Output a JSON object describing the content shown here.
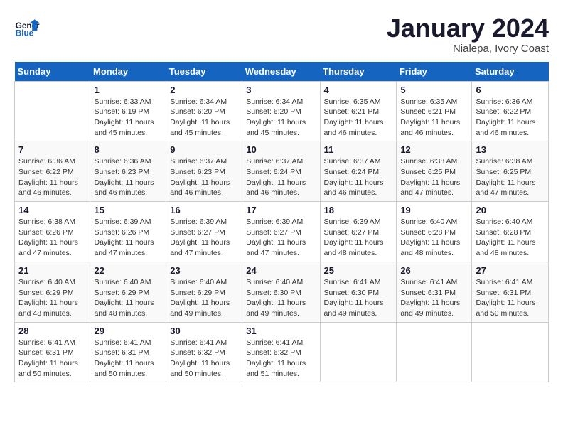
{
  "header": {
    "logo_line1": "General",
    "logo_line2": "Blue",
    "month_title": "January 2024",
    "location": "Nialepa, Ivory Coast"
  },
  "weekdays": [
    "Sunday",
    "Monday",
    "Tuesday",
    "Wednesday",
    "Thursday",
    "Friday",
    "Saturday"
  ],
  "weeks": [
    [
      {
        "day": "",
        "info": ""
      },
      {
        "day": "1",
        "info": "Sunrise: 6:33 AM\nSunset: 6:19 PM\nDaylight: 11 hours and 45 minutes."
      },
      {
        "day": "2",
        "info": "Sunrise: 6:34 AM\nSunset: 6:20 PM\nDaylight: 11 hours and 45 minutes."
      },
      {
        "day": "3",
        "info": "Sunrise: 6:34 AM\nSunset: 6:20 PM\nDaylight: 11 hours and 45 minutes."
      },
      {
        "day": "4",
        "info": "Sunrise: 6:35 AM\nSunset: 6:21 PM\nDaylight: 11 hours and 46 minutes."
      },
      {
        "day": "5",
        "info": "Sunrise: 6:35 AM\nSunset: 6:21 PM\nDaylight: 11 hours and 46 minutes."
      },
      {
        "day": "6",
        "info": "Sunrise: 6:36 AM\nSunset: 6:22 PM\nDaylight: 11 hours and 46 minutes."
      }
    ],
    [
      {
        "day": "7",
        "info": "Sunrise: 6:36 AM\nSunset: 6:22 PM\nDaylight: 11 hours and 46 minutes."
      },
      {
        "day": "8",
        "info": "Sunrise: 6:36 AM\nSunset: 6:23 PM\nDaylight: 11 hours and 46 minutes."
      },
      {
        "day": "9",
        "info": "Sunrise: 6:37 AM\nSunset: 6:23 PM\nDaylight: 11 hours and 46 minutes."
      },
      {
        "day": "10",
        "info": "Sunrise: 6:37 AM\nSunset: 6:24 PM\nDaylight: 11 hours and 46 minutes."
      },
      {
        "day": "11",
        "info": "Sunrise: 6:37 AM\nSunset: 6:24 PM\nDaylight: 11 hours and 46 minutes."
      },
      {
        "day": "12",
        "info": "Sunrise: 6:38 AM\nSunset: 6:25 PM\nDaylight: 11 hours and 47 minutes."
      },
      {
        "day": "13",
        "info": "Sunrise: 6:38 AM\nSunset: 6:25 PM\nDaylight: 11 hours and 47 minutes."
      }
    ],
    [
      {
        "day": "14",
        "info": "Sunrise: 6:38 AM\nSunset: 6:26 PM\nDaylight: 11 hours and 47 minutes."
      },
      {
        "day": "15",
        "info": "Sunrise: 6:39 AM\nSunset: 6:26 PM\nDaylight: 11 hours and 47 minutes."
      },
      {
        "day": "16",
        "info": "Sunrise: 6:39 AM\nSunset: 6:27 PM\nDaylight: 11 hours and 47 minutes."
      },
      {
        "day": "17",
        "info": "Sunrise: 6:39 AM\nSunset: 6:27 PM\nDaylight: 11 hours and 47 minutes."
      },
      {
        "day": "18",
        "info": "Sunrise: 6:39 AM\nSunset: 6:27 PM\nDaylight: 11 hours and 48 minutes."
      },
      {
        "day": "19",
        "info": "Sunrise: 6:40 AM\nSunset: 6:28 PM\nDaylight: 11 hours and 48 minutes."
      },
      {
        "day": "20",
        "info": "Sunrise: 6:40 AM\nSunset: 6:28 PM\nDaylight: 11 hours and 48 minutes."
      }
    ],
    [
      {
        "day": "21",
        "info": "Sunrise: 6:40 AM\nSunset: 6:29 PM\nDaylight: 11 hours and 48 minutes."
      },
      {
        "day": "22",
        "info": "Sunrise: 6:40 AM\nSunset: 6:29 PM\nDaylight: 11 hours and 48 minutes."
      },
      {
        "day": "23",
        "info": "Sunrise: 6:40 AM\nSunset: 6:29 PM\nDaylight: 11 hours and 49 minutes."
      },
      {
        "day": "24",
        "info": "Sunrise: 6:40 AM\nSunset: 6:30 PM\nDaylight: 11 hours and 49 minutes."
      },
      {
        "day": "25",
        "info": "Sunrise: 6:41 AM\nSunset: 6:30 PM\nDaylight: 11 hours and 49 minutes."
      },
      {
        "day": "26",
        "info": "Sunrise: 6:41 AM\nSunset: 6:31 PM\nDaylight: 11 hours and 49 minutes."
      },
      {
        "day": "27",
        "info": "Sunrise: 6:41 AM\nSunset: 6:31 PM\nDaylight: 11 hours and 50 minutes."
      }
    ],
    [
      {
        "day": "28",
        "info": "Sunrise: 6:41 AM\nSunset: 6:31 PM\nDaylight: 11 hours and 50 minutes."
      },
      {
        "day": "29",
        "info": "Sunrise: 6:41 AM\nSunset: 6:31 PM\nDaylight: 11 hours and 50 minutes."
      },
      {
        "day": "30",
        "info": "Sunrise: 6:41 AM\nSunset: 6:32 PM\nDaylight: 11 hours and 50 minutes."
      },
      {
        "day": "31",
        "info": "Sunrise: 6:41 AM\nSunset: 6:32 PM\nDaylight: 11 hours and 51 minutes."
      },
      {
        "day": "",
        "info": ""
      },
      {
        "day": "",
        "info": ""
      },
      {
        "day": "",
        "info": ""
      }
    ]
  ]
}
